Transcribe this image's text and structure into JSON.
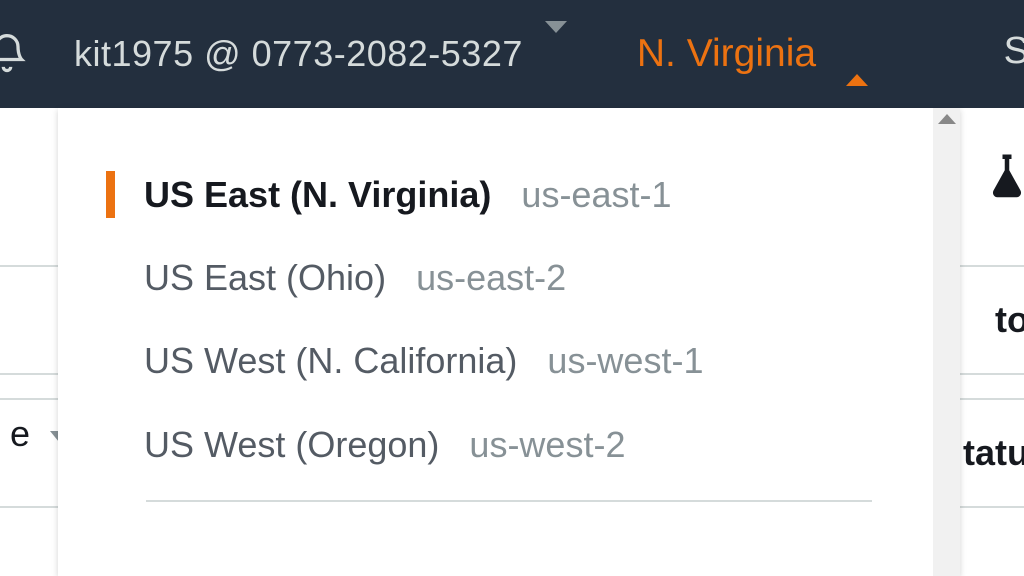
{
  "header": {
    "account_text": "kit1975 @ 0773-2082-5327",
    "region_label": "N. Virginia",
    "right_fragment": "S"
  },
  "regions": [
    {
      "name": "US East (N. Virginia)",
      "code": "us-east-1",
      "selected": true
    },
    {
      "name": "US East (Ohio)",
      "code": "us-east-2",
      "selected": false
    },
    {
      "name": "US West (N. California)",
      "code": "us-west-1",
      "selected": false
    },
    {
      "name": "US West (Oregon)",
      "code": "us-west-2",
      "selected": false
    }
  ],
  "bg": {
    "row1_right": "to",
    "row2_right": "tatu",
    "row2_left": "e"
  },
  "colors": {
    "accent": "#ec7211",
    "nav_bg": "#232f3e"
  }
}
